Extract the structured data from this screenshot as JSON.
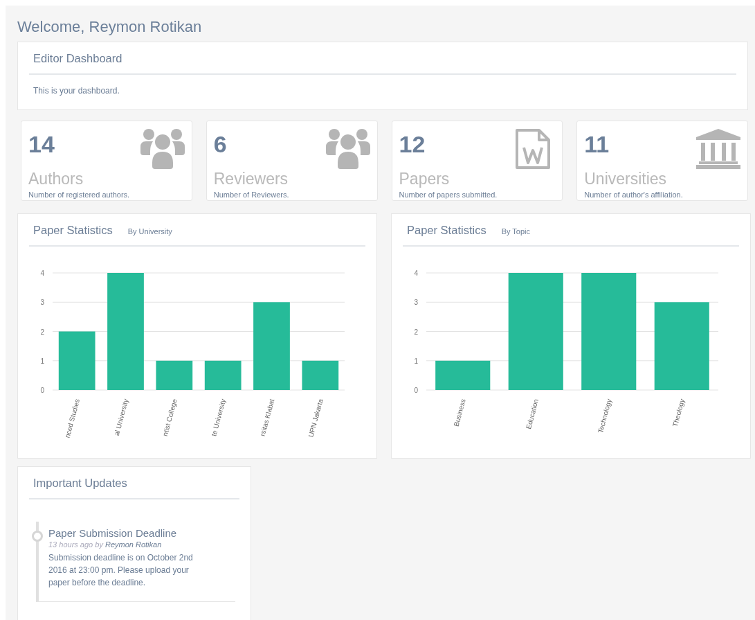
{
  "welcome": "Welcome, Reymon Rotikan",
  "dashboard": {
    "title": "Editor Dashboard",
    "text": "This is your dashboard."
  },
  "stats": [
    {
      "kind": "people",
      "value": "14",
      "label": "Authors",
      "description": "Number of registered authors."
    },
    {
      "kind": "people",
      "value": "6",
      "label": "Reviewers",
      "description": "Number of Reviewers."
    },
    {
      "kind": "document",
      "value": "12",
      "label": "Papers",
      "description": "Number of papers submitted."
    },
    {
      "kind": "institution",
      "value": "11",
      "label": "Universities",
      "description": "Number of author's affiliation."
    }
  ],
  "charts": [
    {
      "title": "Paper Statistics",
      "subtitle": "By University",
      "chart_data": {
        "type": "bar",
        "categories": [
          "nced Studies",
          "al University",
          "ntist College",
          "te University",
          "rsitas Klabat",
          "UPN Jakarta"
        ],
        "values": [
          2,
          4,
          1,
          1,
          3,
          1
        ],
        "grid": true,
        "ylim": [
          0,
          4
        ],
        "yticks": [
          0,
          1,
          2,
          3,
          4
        ]
      }
    },
    {
      "title": "Paper Statistics",
      "subtitle": "By Topic",
      "chart_data": {
        "type": "bar",
        "categories": [
          "Business",
          "Education",
          "Technology",
          "Theology"
        ],
        "values": [
          1,
          4,
          4,
          3
        ],
        "grid": true,
        "ylim": [
          0,
          4
        ],
        "yticks": [
          0,
          1,
          2,
          3,
          4
        ]
      }
    }
  ],
  "updates": {
    "title": "Important Updates",
    "items": [
      {
        "title": "Paper Submission Deadline",
        "time": "13 hours ago",
        "by": "by",
        "author": "Reymon Rotikan",
        "text": "Submission deadline is on October 2nd 2016 at 23:00 pm. Please upload your paper before the deadline."
      }
    ]
  }
}
